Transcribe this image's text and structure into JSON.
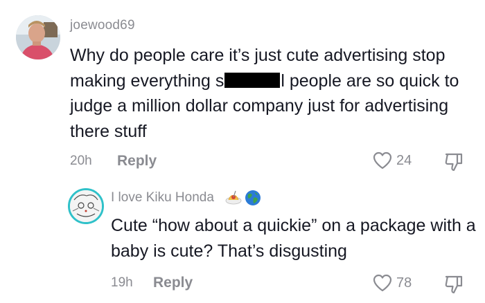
{
  "comment": {
    "username": "joewood69",
    "text_before_redaction": "Why do people care it’s just cute advertising stop making everything s",
    "text_after_redaction": "l people are so quick to judge a million dollar company just for advertising there stuff",
    "time": "20h",
    "reply_label": "Reply",
    "likes": "24",
    "avatar_icon": "profile-photo"
  },
  "reply": {
    "username": "I love Kiku Honda",
    "username_emojis": [
      "spaghetti-emoji",
      "globe-emoji"
    ],
    "text": "Cute “how about a quickie” on a package with a baby is cute? That’s disgusting",
    "time": "19h",
    "reply_label": "Reply",
    "likes": "78",
    "avatar_icon": "anime-sketch-avatar"
  },
  "colors": {
    "text_primary": "#161823",
    "text_secondary": "#8a8b91",
    "avatar_ring": "#2fc1c9"
  }
}
